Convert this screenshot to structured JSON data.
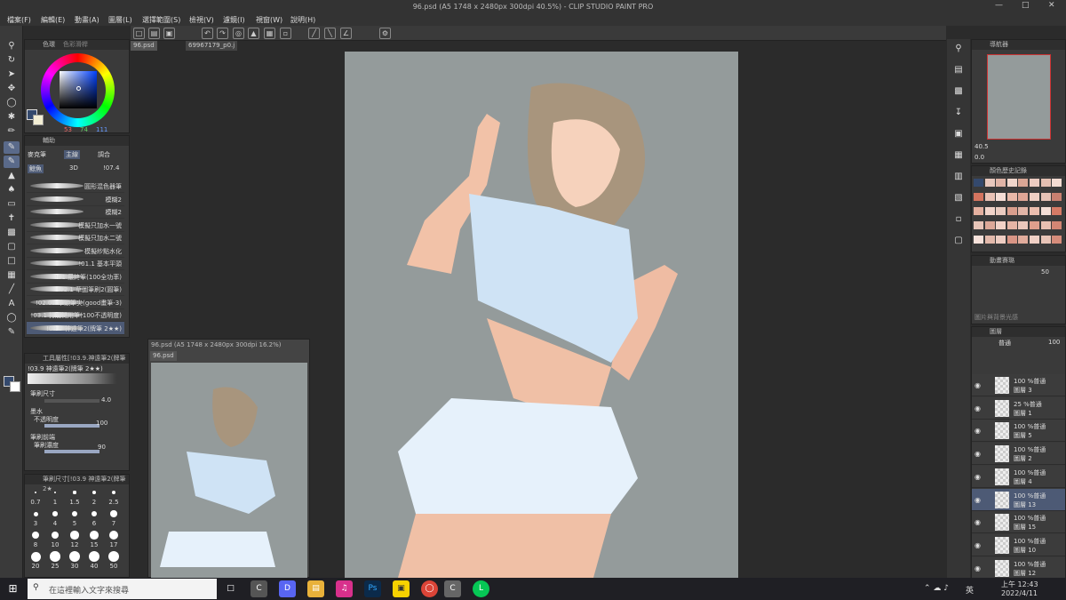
{
  "window": {
    "title": "96.psd (A5 1748 x 2480px 300dpi 40.5%) - CLIP STUDIO PAINT PRO"
  },
  "menu": [
    "檔案(F)",
    "編輯(E)",
    "動畫(A)",
    "圖層(L)",
    "選擇範圍(S)",
    "檢視(V)",
    "濾鏡(I)",
    "視窗(W)",
    "說明(H)"
  ],
  "tabs": {
    "active": "96.psd",
    "second": "69967179_p0.j"
  },
  "color_panel": {
    "tab1": "色環",
    "tab2": "色彩滑桿",
    "r": "53",
    "g": "74",
    "b": "111",
    "main_color": "#34496d"
  },
  "tool_panel": {
    "tab1": "輔助",
    "sub1": "麥克筆",
    "sub2": "主線",
    "sub3": "調合",
    "sub4": "鯨魚",
    "sub5": "3D",
    "sub6": "!07.4"
  },
  "brushes": [
    "圓形混色器筆",
    "模糊2",
    "模糊2",
    "模擬只加水一號",
    "模擬只加水二號",
    "模擬紗點水化",
    "!01.1 基本平頭",
    "!01.最終筆(100全功率)",
    "!02.1 草圖筆刷2(圓筆)",
    "!02.05.筆頭筆尖(good畫筆-3)",
    "!03.1 打底糙用筆(100不透明度)",
    "!03.9 神遠筆2(牌筆 2★★)"
  ],
  "tool_property": {
    "header": "工具屬性[!03.9.神遠筆2(牌筆",
    "preset": "!03.9 神遠筆2(牌筆 2★★)",
    "brush_size_label": "筆刷尺寸",
    "brush_size": "4.0",
    "ink_label": "墨水",
    "opacity_label": "不透明度",
    "opacity": "100",
    "tip_label": "筆刷前端",
    "density_label": "筆刷濃度",
    "density": "90"
  },
  "size_panel": {
    "header": "筆刷尺寸[!03.9 神遠筆2(牌筆 2★",
    "sizes": [
      "0.7",
      "1",
      "1.5",
      "2",
      "2.5",
      "3",
      "4",
      "5",
      "6",
      "7",
      "8",
      "10",
      "12",
      "15",
      "17",
      "20",
      "25",
      "30",
      "40",
      "50"
    ]
  },
  "subview": {
    "title": "96.psd (A5 1748 x 2480px 300dpi 16.2%)",
    "tab": "96.psd"
  },
  "navigator": {
    "tab": "導航器",
    "zoom": "40.5",
    "rotate": "0.0"
  },
  "color_history": {
    "tab": "顏色歷史記錄",
    "swatches": [
      "#34496d",
      "#e8c8bd",
      "#e0b4a6",
      "#f0d6cc",
      "#d9a695",
      "#eccbc0",
      "#e3bfb2",
      "#f3dbd2",
      "#d4745f",
      "#eac2b5",
      "#f5ddd5",
      "#e8b8a8",
      "#dfa696",
      "#f0cfc4",
      "#e6c2b6",
      "#c98070",
      "#e4b0a0",
      "#f2d4ca",
      "#eacbc0",
      "#d99e8d",
      "#e2b5a7",
      "#ebbdae",
      "#f4ded6",
      "#d57a66",
      "#e7c4b8",
      "#dca898",
      "#f1d2c7",
      "#e5b5a6",
      "#ecc8bc",
      "#de9f8d",
      "#e9c0b2",
      "#d28674",
      "#f6e1da",
      "#e3b9ab",
      "#eecdc2",
      "#d99585",
      "#e1ac9c",
      "#f0d0c5",
      "#e8c4b7",
      "#d68c7b"
    ]
  },
  "animation_cels": {
    "tab": "動畫賽璐",
    "value": "50",
    "hint": "圖片與背景光感"
  },
  "layers": {
    "tab": "圖層",
    "blend": "普通",
    "opacity": "100",
    "items": [
      {
        "mode": "100 %普通",
        "name": "圖層 3"
      },
      {
        "mode": "25 %普通",
        "name": "圖層 1"
      },
      {
        "mode": "100 %普通",
        "name": "圖層 5"
      },
      {
        "mode": "100 %普通",
        "name": "圖層 2"
      },
      {
        "mode": "100 %普通",
        "name": "圖層 4"
      },
      {
        "mode": "100 %普通",
        "name": "圖層 13"
      },
      {
        "mode": "100 %普通",
        "name": "圖層 15"
      },
      {
        "mode": "100 %普通",
        "name": "圖層 10"
      },
      {
        "mode": "100 %普通",
        "name": "圖層 12"
      }
    ],
    "selected_index": 5
  },
  "taskbar": {
    "search_placeholder": "在這裡輸入文字來搜尋",
    "time": "上午 12:43",
    "date": "2022/4/11",
    "ime": "英"
  }
}
